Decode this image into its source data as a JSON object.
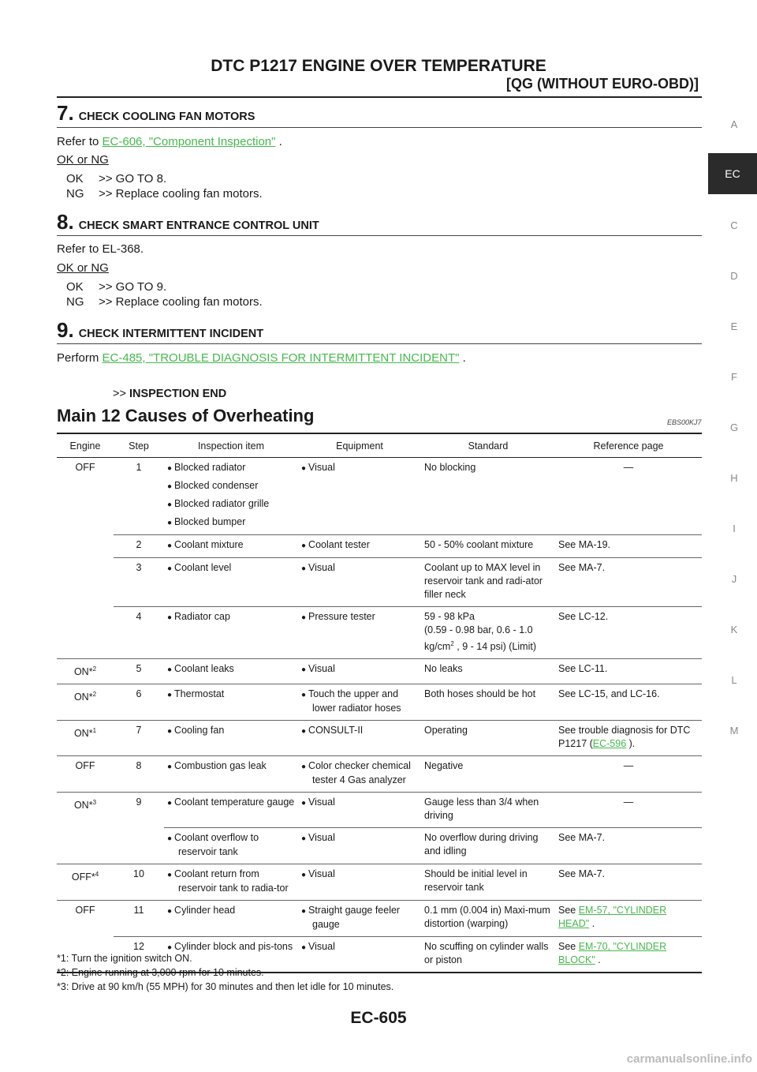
{
  "header": {
    "title": "DTC P1217 ENGINE OVER TEMPERATURE",
    "subtitle": "[QG (WITHOUT EURO-OBD)]"
  },
  "side_index": [
    "A",
    "EC",
    "C",
    "D",
    "E",
    "F",
    "G",
    "H",
    "I",
    "J",
    "K",
    "L",
    "M"
  ],
  "steps": [
    {
      "num": "7.",
      "title": "CHECK COOLING FAN MOTORS",
      "text_prefix": "Refer to ",
      "link": "EC-606, \"Component Inspection\"",
      "text_suffix": " .",
      "ok_ng": "OK or NG",
      "ok_key": "OK",
      "ok_val": ">> GO TO 8.",
      "ng_key": "NG",
      "ng_val": ">> Replace cooling fan motors."
    },
    {
      "num": "8.",
      "title": "CHECK SMART ENTRANCE CONTROL UNIT",
      "text": "Refer to EL-368.",
      "ok_ng": "OK or NG",
      "ok_key": "OK",
      "ok_val": ">> GO TO 9.",
      "ng_key": "NG",
      "ng_val": ">> Replace cooling fan motors."
    },
    {
      "num": "9.",
      "title": "CHECK INTERMITTENT INCIDENT",
      "text_prefix": "Perform ",
      "link": "EC-485, \"TROUBLE DIAGNOSIS FOR INTERMITTENT INCIDENT\"",
      "text_suffix": " .",
      "end_prefix": ">>",
      "end_label": "INSPECTION END"
    }
  ],
  "section": {
    "title": "Main 12 Causes of Overheating",
    "code": "EBS00KJ7"
  },
  "table": {
    "headers": [
      "Engine",
      "Step",
      "Inspection item",
      "Equipment",
      "Standard",
      "Reference page"
    ],
    "r1": {
      "engine": "OFF",
      "step": "1",
      "items": [
        "Blocked radiator",
        "Blocked condenser",
        "Blocked radiator grille",
        "Blocked bumper"
      ],
      "equip": "Visual",
      "std": "No blocking",
      "ref": "—"
    },
    "r2": {
      "step": "2",
      "item": "Coolant mixture",
      "equip": "Coolant tester",
      "std": "50 - 50% coolant mixture",
      "ref": "See MA-19."
    },
    "r3": {
      "step": "3",
      "item": "Coolant level",
      "equip": "Visual",
      "std": "Coolant up to MAX level in reservoir tank and radi-ator filler neck",
      "ref": "See MA-7."
    },
    "r4": {
      "step": "4",
      "item": "Radiator cap",
      "equip": "Pressure tester",
      "std_a": "59 - 98 kPa",
      "std_b": "(0.59 - 0.98 bar, 0.6 - 1.0",
      "std_c": "kg/cm",
      "std_sup": "2",
      "std_d": " , 9 - 14 psi) (Limit)",
      "ref": "See LC-12."
    },
    "r5": {
      "engine": "ON*",
      "sup": "2",
      "step": "5",
      "item": "Coolant leaks",
      "equip": "Visual",
      "std": "No leaks",
      "ref": "See LC-11."
    },
    "r6": {
      "engine": "ON*",
      "sup": "2",
      "step": "6",
      "item": "Thermostat",
      "equip": "Touch the upper and lower radiator hoses",
      "std": "Both hoses should be hot",
      "ref": "See LC-15, and LC-16."
    },
    "r7": {
      "engine": "ON*",
      "sup": "1",
      "step": "7",
      "item": "Cooling fan",
      "equip": "CONSULT-II",
      "std": "Operating",
      "ref_a": "See trouble diagnosis for DTC P1217 (",
      "ref_link": "EC-596",
      "ref_b": " )."
    },
    "r8": {
      "engine": "OFF",
      "step": "8",
      "item": "Combustion gas leak",
      "equip": "Color checker chemical tester 4 Gas analyzer",
      "std": "Negative",
      "ref": "—"
    },
    "r9": {
      "engine": "ON*",
      "sup": "3",
      "step": "9",
      "item": "Coolant temperature gauge",
      "equip": "Visual",
      "std": "Gauge less than 3/4 when driving",
      "ref": "—"
    },
    "r9b": {
      "item": "Coolant overflow to reservoir tank",
      "equip": "Visual",
      "std": "No overflow during driving and idling",
      "ref": "See MA-7."
    },
    "r10": {
      "engine": "OFF*",
      "sup": "4",
      "step": "10",
      "item": "Coolant return from reservoir tank to radia-tor",
      "equip": "Visual",
      "std": "Should be initial level in reservoir tank",
      "ref": "See MA-7."
    },
    "r11": {
      "engine": "OFF",
      "step": "11",
      "item": "Cylinder head",
      "equip": "Straight gauge feeler gauge",
      "std": "0.1 mm (0.004 in) Maxi-mum distortion (warping)",
      "ref_a": "See ",
      "ref_link": "EM-57, \"CYLINDER HEAD\"",
      "ref_b": " ."
    },
    "r12": {
      "step": "12",
      "item": "Cylinder block and pis-tons",
      "equip": "Visual",
      "std": "No scuffing on cylinder walls or piston",
      "ref_a": "See ",
      "ref_link": "EM-70, \"CYLINDER BLOCK\"",
      "ref_b": " ."
    }
  },
  "footnotes": [
    "*1: Turn the ignition switch ON.",
    "*2: Engine running at 3,000 rpm for 10 minutes.",
    "*3: Drive at 90 km/h (55 MPH) for 30 minutes and then let idle for 10 minutes."
  ],
  "page_number": "EC-605",
  "watermark": "carmanualsonline.info",
  "colors": {
    "link": "#46b84d",
    "active_tab": "#2b2b2b"
  }
}
